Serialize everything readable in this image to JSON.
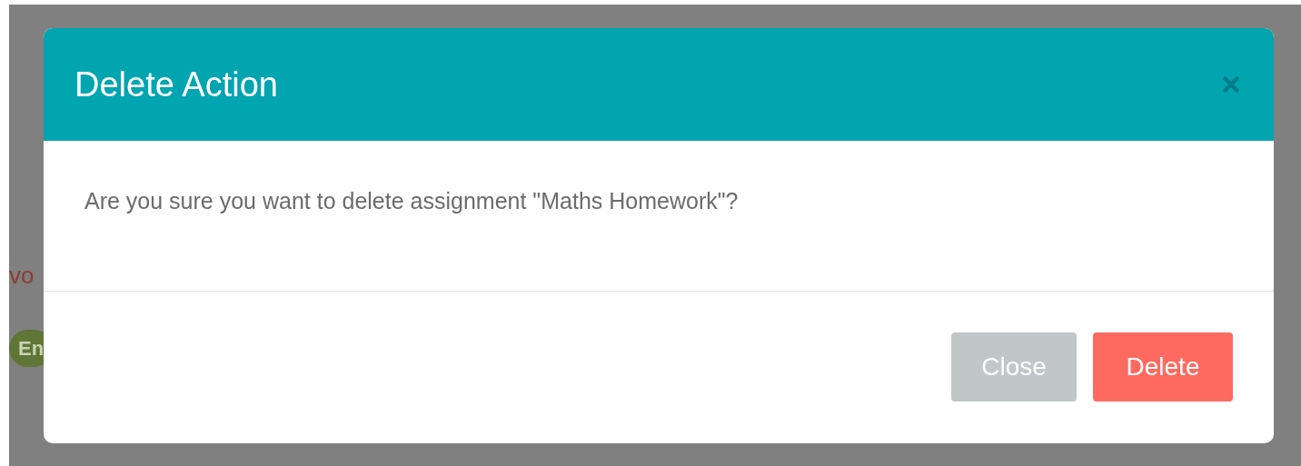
{
  "background": {
    "fragments": [
      {
        "kind": "text",
        "text": "vo"
      },
      {
        "kind": "badge",
        "text": "En"
      }
    ]
  },
  "dialog": {
    "title": "Delete Action",
    "message": "Are you sure you want to delete assignment \"Maths Homework\"?",
    "buttons": [
      {
        "label": "Close",
        "kind": "secondary"
      },
      {
        "label": "Delete",
        "kind": "danger"
      }
    ]
  }
}
